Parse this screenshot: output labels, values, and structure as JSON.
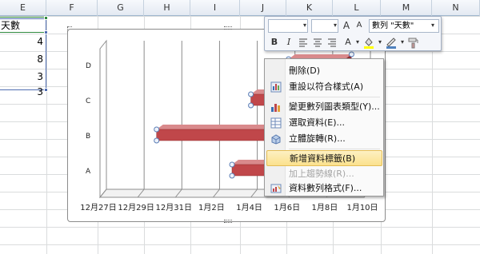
{
  "columns": [
    "E",
    "F",
    "G",
    "H",
    "I",
    "J",
    "K",
    "L",
    "M",
    "N"
  ],
  "cells": {
    "header": "天數",
    "values": [
      "4",
      "8",
      "3",
      "3"
    ]
  },
  "mini_toolbar": {
    "font_box": "",
    "size_box": "",
    "grow_font": "A",
    "shrink_font": "A",
    "series_select": "數列 \"天數\"",
    "bold": "B",
    "italic": "I",
    "font_color": "A"
  },
  "context_menu": {
    "items": [
      {
        "label": "刪除(D)",
        "icon": "delete-icon",
        "enabled": true,
        "highlighted": false
      },
      {
        "label": "重設以符合樣式(A)",
        "icon": "reset-style-icon",
        "enabled": true,
        "highlighted": false
      },
      {
        "label": "變更數列圖表類型(Y)...",
        "icon": "chart-type-icon",
        "enabled": true,
        "highlighted": false
      },
      {
        "label": "選取資料(E)...",
        "icon": "select-data-icon",
        "enabled": true,
        "highlighted": false
      },
      {
        "label": "立體旋轉(R)...",
        "icon": "3d-rotation-icon",
        "enabled": true,
        "highlighted": false
      },
      {
        "label": "新增資料標籤(B)",
        "icon": "",
        "enabled": true,
        "highlighted": true
      },
      {
        "label": "加上趨勢線(R)...",
        "icon": "",
        "enabled": false,
        "highlighted": false
      },
      {
        "label": "資料數列格式(F)...",
        "icon": "format-series-icon",
        "enabled": true,
        "highlighted": false
      }
    ]
  },
  "chart_data": {
    "type": "bar",
    "categories": [
      "A",
      "B",
      "C",
      "D"
    ],
    "x_tick_labels": [
      "12月27日",
      "12月29日",
      "12月31日",
      "1月2日",
      "1月4日",
      "1月6日",
      "1月8日",
      "1月10日"
    ],
    "xlim": [
      "12月27日",
      "1月10日"
    ],
    "series": [
      {
        "name": "天數",
        "start": [
          "1月3日",
          "12月30日",
          "1月4日",
          "1月6日"
        ],
        "values": [
          4,
          8,
          3,
          3
        ]
      }
    ],
    "bar_color": "#c0474a",
    "title": "",
    "xlabel": "",
    "ylabel": ""
  }
}
